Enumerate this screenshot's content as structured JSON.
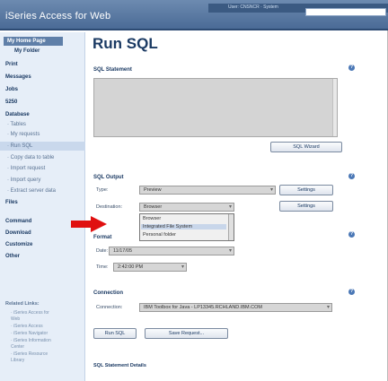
{
  "header": {
    "app_title": "iSeries Access for Web",
    "user_label": "User: CNSNCR · System"
  },
  "sidebar": {
    "items": [
      {
        "label": "My Home Page"
      },
      {
        "label": "My Folder"
      },
      {
        "label": "Print"
      },
      {
        "label": "Messages"
      },
      {
        "label": "Jobs"
      },
      {
        "label": "5250"
      },
      {
        "label": "Database"
      },
      {
        "label": "· Tables"
      },
      {
        "label": "· My requests"
      },
      {
        "label": "· Run SQL"
      },
      {
        "label": "· Copy data to table"
      },
      {
        "label": "· Import request"
      },
      {
        "label": "· Import query"
      },
      {
        "label": "· Extract server data"
      },
      {
        "label": "Files"
      },
      {
        "label": "Command"
      },
      {
        "label": "Download"
      },
      {
        "label": "Customize"
      },
      {
        "label": "Other"
      }
    ],
    "related_title": "Related Links:",
    "related_items": [
      "· iSeries Access for",
      "  Web",
      "· iSeries Access",
      "· iSeries Navigator",
      "· iSeries Information",
      "  Center",
      "· iSeries Resource",
      "  Library"
    ]
  },
  "main": {
    "page_title": "Run SQL",
    "sql_statement_title": "SQL Statement",
    "sql_statement_value": "",
    "sql_wizard_label": "SQL Wizard",
    "sql_output_title": "SQL Output",
    "type_label": "Type:",
    "type_value": "Preview",
    "settings_label": "Settings",
    "destination_label": "Destination:",
    "destination_value": "Browser",
    "destination_options": [
      "Browser",
      "Integrated File System",
      "Personal folder"
    ],
    "format_label": "Format",
    "date_label": "Date:",
    "date_value": "11/17/05",
    "time_label": "Time:",
    "time_value": "2:42:00 PM",
    "connection_title": "Connection",
    "connection_label": "Connection:",
    "connection_value": "IBM Toolbox for Java - LP13345.RCHLAND.IBM.COM",
    "run_sql_label": "Run SQL",
    "save_request_label": "Save Request...",
    "details_title": "SQL Statement Details"
  },
  "icons": {
    "help": "question-icon",
    "arrow": "red-arrow-icon",
    "chevron": "chevron-down-icon"
  },
  "colors": {
    "header": "#4a6b96",
    "sidebar": "#e6eef8",
    "accent_arrow": "#e01010",
    "title": "#1b3a63"
  }
}
